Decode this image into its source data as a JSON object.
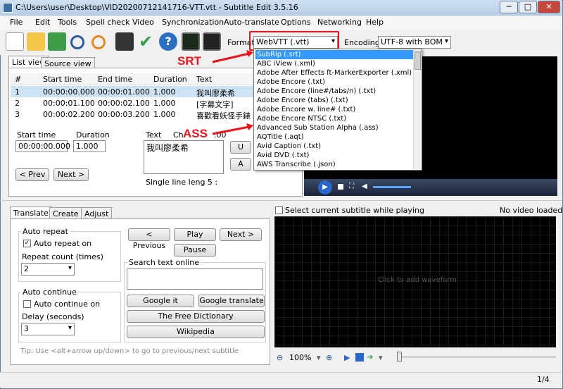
{
  "window": {
    "title": "C:\\Users\\user\\Desktop\\VID20200712141716-VTT.vtt - Subtitle Edit 3.5.16",
    "min": "─",
    "max": "□",
    "close": "✕"
  },
  "menu": [
    "File",
    "Edit",
    "Tools",
    "Spell check",
    "Video",
    "Synchronization",
    "Auto-translate",
    "Options",
    "Networking",
    "Help"
  ],
  "toolbar": {
    "format_label": "Format",
    "format_value": "WebVTT (.vtt)",
    "encoding_label": "Encoding",
    "encoding_value": "UTF-8 with BOM"
  },
  "tabs": {
    "list_view": "List view",
    "source_view": "Source view"
  },
  "table": {
    "headers": [
      "#",
      "Start time",
      "End time",
      "Duration",
      "Text"
    ],
    "rows": [
      [
        "1",
        "00:00:00.000",
        "00:00:01.000",
        "1.000",
        "我叫廖柔希"
      ],
      [
        "2",
        "00:00:01.100",
        "00:00:02.100",
        "1.000",
        "[字幕文字]"
      ],
      [
        "3",
        "00:00:02.200",
        "00:00:03.200",
        "1.000",
        "喜歡看妖怪手錶"
      ]
    ]
  },
  "editor": {
    "start_label": "Start time",
    "start_value": "00:00:00.000",
    "duration_label": "Duration",
    "duration_value": "1.000",
    "text_label": "Text",
    "chars_label": "Ch",
    "chars_value": ".00",
    "text_value": "我叫廖柔希",
    "single_line": "Single line leng 5 :",
    "prev": "< Prev",
    "next": "Next >",
    "u_btn": "U",
    "a_btn": "A"
  },
  "dropdown": [
    "SubRip (.srt)",
    "ABC iView (.xml)",
    "Adobe After Effects ft-MarkerExporter (.xml)",
    "Adobe Encore (.txt)",
    "Adobe Encore (line#/tabs/n) (.txt)",
    "Adobe Encore (tabs) (.txt)",
    "Adobe Encore w. line# (.txt)",
    "Adobe Encore NTSC (.txt)",
    "Advanced Sub Station Alpha (.ass)",
    "AQTitle (.aqt)",
    "Avid Caption (.txt)",
    "Avid DVD (.txt)",
    "AWS Transcribe (.json)"
  ],
  "annotations": {
    "srt": "SRT",
    "ass": "ASS"
  },
  "bottom_tabs": {
    "translate": "Translate",
    "create": "Create",
    "adjust": "Adjust"
  },
  "translate": {
    "auto_repeat": "Auto repeat",
    "auto_repeat_on": "Auto repeat on",
    "repeat_count": "Repeat count (times)",
    "repeat_value": "2",
    "auto_continue": "Auto continue",
    "auto_continue_on": "Auto continue on",
    "delay": "Delay (seconds)",
    "delay_value": "3",
    "previous": "< Previous",
    "play": "Play",
    "next": "Next >",
    "pause": "Pause",
    "search_online": "Search text online",
    "google_it": "Google it",
    "google_translate": "Google translate",
    "free_dictionary": "The Free Dictionary",
    "wikipedia": "Wikipedia",
    "tip": "Tip: Use <alt+arrow up/down> to go to previous/next subtitle"
  },
  "waveform": {
    "select_current": "Select current subtitle while playing",
    "no_video": "No video loaded",
    "click_add": "Click to add waveform",
    "zoom": "100%"
  },
  "status": {
    "page": "1/4"
  }
}
